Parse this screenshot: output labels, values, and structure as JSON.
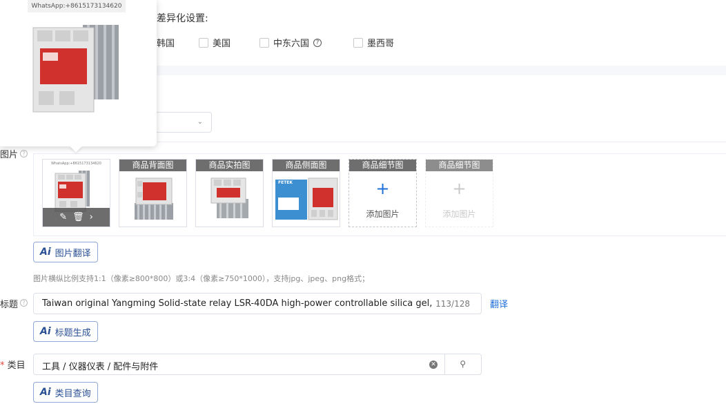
{
  "market": {
    "title": "差异化设置:",
    "options": [
      {
        "label": "韩国"
      },
      {
        "label": "美国"
      },
      {
        "label": "中东六国"
      },
      {
        "label": "墨西哥"
      }
    ]
  },
  "popover": {
    "whatsapp": "WhatsApp:+8615173134620"
  },
  "images": {
    "label": "图片",
    "main_watermark": "WhatsApp:+8615173134620",
    "slots": [
      {
        "caption": "商品背面图"
      },
      {
        "caption": "商品实拍图"
      },
      {
        "caption": "商品侧面图"
      },
      {
        "caption": "商品细节图",
        "add_label": "添加图片"
      },
      {
        "caption": "商品细节图",
        "add_label": "添加图片"
      }
    ],
    "translate_button": "图片翻译",
    "hint": "图片横纵比例支持1:1（像素≥800*800）或3:4（像素≥750*1000），支持jpg、jpeg、png格式；",
    "ai_label": "Ai",
    "fetek_label": "FETEK"
  },
  "title_field": {
    "label": "标题",
    "value": "Taiwan original   Yangming Solid-state relay LSR-40DA high-power controllable silica gel, fal",
    "count": "113/128",
    "translate_link": "翻译",
    "generate_button": "标题生成"
  },
  "category": {
    "required_mark": "*",
    "label": "类目",
    "value": "工具 / 仪器仪表 / 配件与附件",
    "query_button": "类目查询"
  },
  "colors": {
    "accent": "#1e6fd9",
    "relay_red": "#d0312d"
  }
}
